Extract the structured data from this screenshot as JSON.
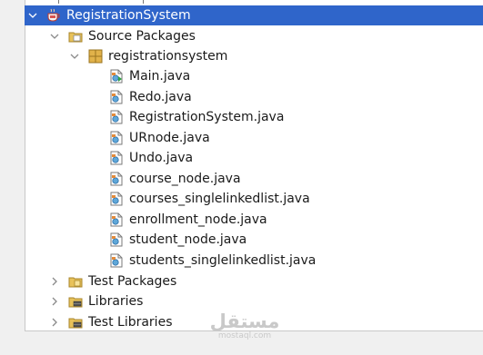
{
  "tree": {
    "project": {
      "label": "RegistrationSystem",
      "icon": "coffee-cup-project-icon",
      "expanded": true,
      "selected": true
    },
    "source_packages": {
      "label": "Source Packages",
      "icon": "source-folder-icon",
      "expanded": true
    },
    "package": {
      "label": "registrationsystem",
      "icon": "package-icon",
      "expanded": true
    },
    "files": [
      {
        "label": "Main.java",
        "icon": "java-main-class-icon"
      },
      {
        "label": "Redo.java",
        "icon": "java-class-icon"
      },
      {
        "label": "RegistrationSystem.java",
        "icon": "java-class-icon"
      },
      {
        "label": "URnode.java",
        "icon": "java-class-icon"
      },
      {
        "label": "Undo.java",
        "icon": "java-class-icon"
      },
      {
        "label": "course_node.java",
        "icon": "java-class-icon"
      },
      {
        "label": "courses_singlelinkedlist.java",
        "icon": "java-class-icon"
      },
      {
        "label": "enrollment_node.java",
        "icon": "java-class-icon"
      },
      {
        "label": "student_node.java",
        "icon": "java-class-icon"
      },
      {
        "label": "students_singlelinkedlist.java",
        "icon": "java-class-icon"
      }
    ],
    "others": [
      {
        "label": "Test Packages",
        "icon": "test-folder-icon",
        "expanded": false
      },
      {
        "label": "Libraries",
        "icon": "library-folder-icon",
        "expanded": false
      },
      {
        "label": "Test Libraries",
        "icon": "library-folder-icon",
        "expanded": false
      }
    ]
  },
  "watermark": {
    "arabic": "مستقل",
    "latin": "mostaql.com"
  },
  "colors": {
    "selection": "#2f65ca",
    "folder": "#e8c25a",
    "package": "#e1b24a"
  }
}
